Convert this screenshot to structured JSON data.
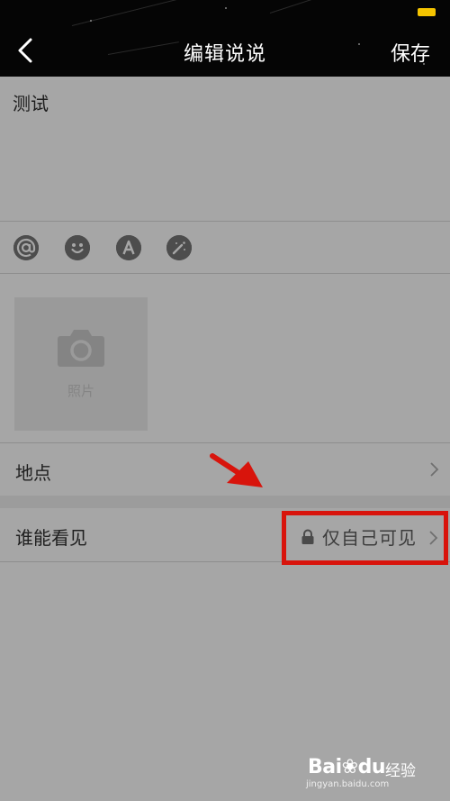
{
  "nav": {
    "title": "编辑说说",
    "save_label": "保存",
    "back_icon": "chevron-left-icon",
    "background": "#050505"
  },
  "post": {
    "text": "测试"
  },
  "toolbar": {
    "icons": [
      "at-icon",
      "emoji-icon",
      "font-icon",
      "magic-wand-icon"
    ]
  },
  "photo": {
    "label": "照片",
    "icon": "camera-icon"
  },
  "location_row": {
    "label": "地点"
  },
  "visibility_row": {
    "label": "谁能看见",
    "value": "仅自己可见",
    "icon": "lock-icon"
  },
  "annotation": {
    "highlight_color": "#d8140c"
  },
  "watermark": {
    "brand": "Bai",
    "brand2": "du",
    "experience": "经验",
    "url": "jingyan.baidu.com"
  }
}
